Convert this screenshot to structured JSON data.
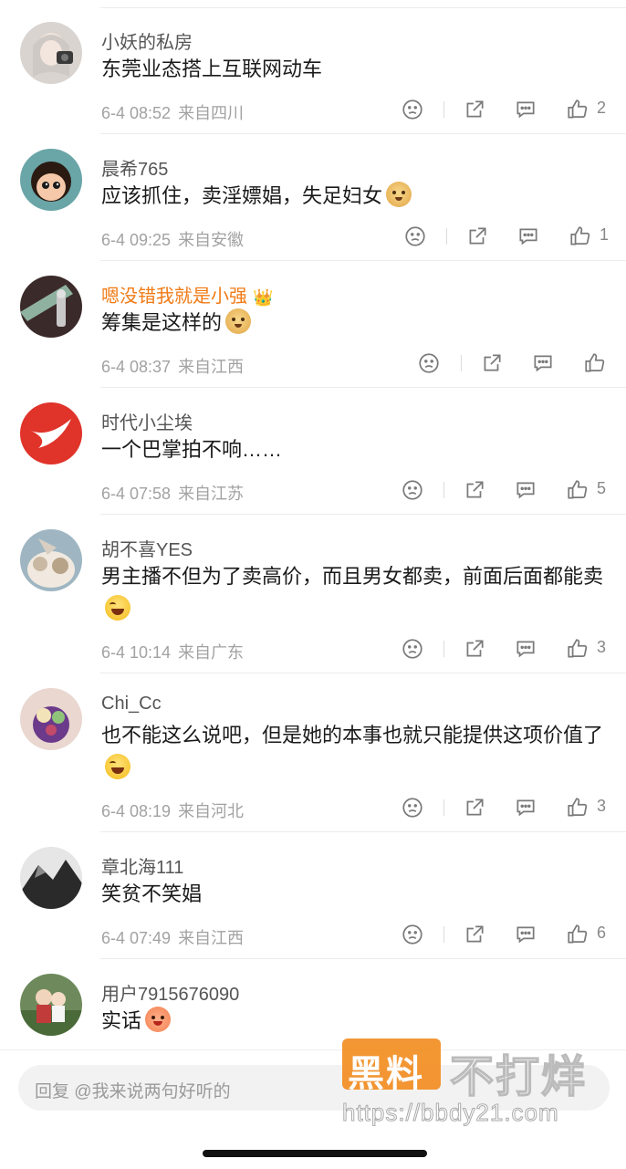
{
  "comments": [
    {
      "name": "小妖的私房",
      "text": "东莞业态搭上互联网动车",
      "emoji": "",
      "time": "6-4 08:52",
      "location": "来自四川",
      "likes": "2"
    },
    {
      "name": "晨希765",
      "text": "应该抓住，卖淫嫖娼，失足妇女",
      "emoji": "doge",
      "time": "6-4 09:25",
      "location": "来自安徽",
      "likes": "1"
    },
    {
      "name": "嗯没错我就是小强",
      "text": "筹集是这样的",
      "emoji": "doge",
      "time": "6-4 08:37",
      "location": "来自江西",
      "likes": ""
    },
    {
      "name": "时代小尘埃",
      "text": "一个巴掌拍不响……",
      "emoji": "",
      "time": "6-4 07:58",
      "location": "来自江苏",
      "likes": "5"
    },
    {
      "name": "胡不喜YES",
      "text": "男主播不但为了卖高价，而且男女都卖，前面后面都能卖",
      "emoji": "laugh",
      "time": "6-4 10:14",
      "location": "来自广东",
      "likes": "3"
    },
    {
      "name": "Chi_Cc",
      "text": "也不能这么说吧，但是她的本事也就只能提供这项价值了",
      "emoji": "laugh",
      "time": "6-4 08:19",
      "location": "来自河北",
      "likes": "3"
    },
    {
      "name": "章北海111",
      "text": "笑贫不笑娼",
      "emoji": "",
      "time": "6-4 07:49",
      "location": "来自江西",
      "likes": "6"
    },
    {
      "name": "用户7915676090",
      "text": "实话",
      "emoji": "happy",
      "time": "",
      "location": "",
      "likes": ""
    }
  ],
  "reply": {
    "placeholder": "回复 @我来说两句好听的"
  },
  "watermark": {
    "badge": "黑料",
    "title": "不打烊",
    "url": "https://bbdy21.com"
  },
  "colors": {
    "vip_name": "#f07a14",
    "meta": "#a2a2a2",
    "divider": "#ececec"
  }
}
